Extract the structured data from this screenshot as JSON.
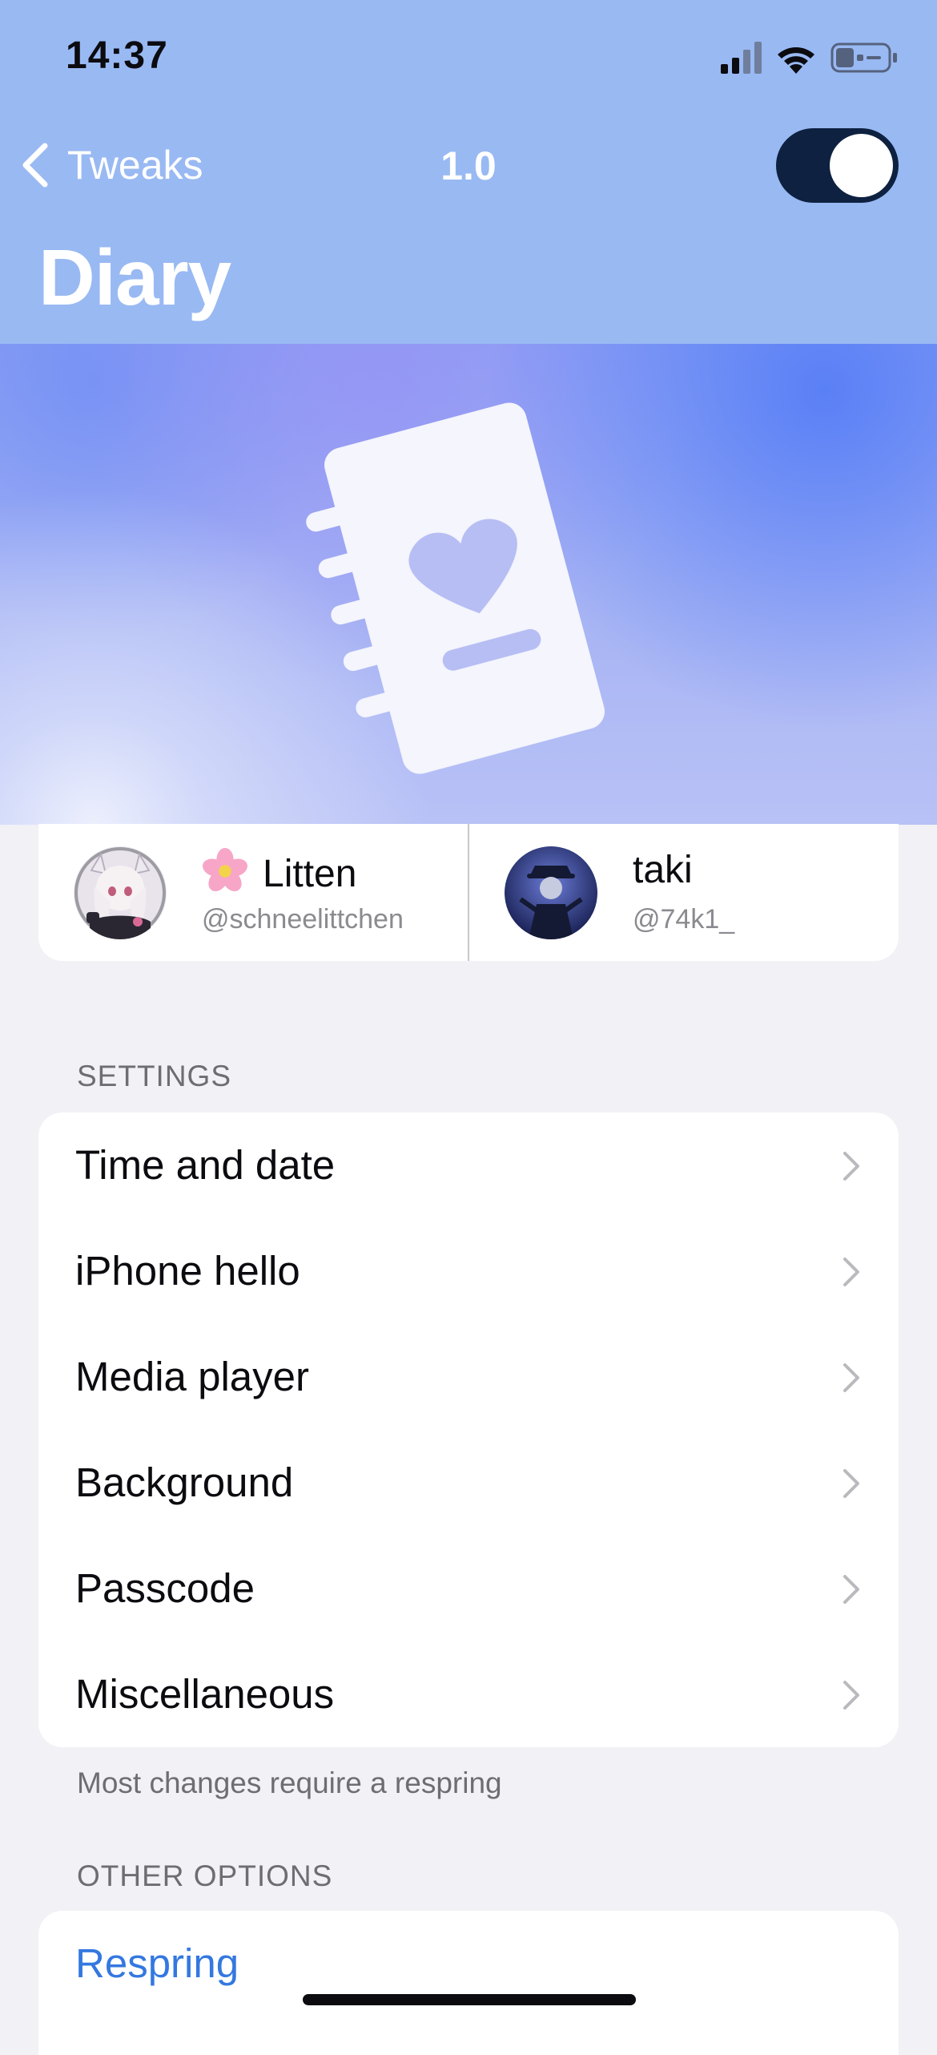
{
  "status_bar": {
    "time": "14:37"
  },
  "nav": {
    "back_label": "Tweaks",
    "version": "1.0",
    "toggle_on": true,
    "title": "Diary"
  },
  "authors": [
    {
      "name": "Litten",
      "handle": "@schneelittchen",
      "emoji": "cherry-blossom-icon"
    },
    {
      "name": "taki",
      "handle": "@74k1_"
    }
  ],
  "settings": {
    "header": "SETTINGS",
    "items": [
      {
        "label": "Time and date"
      },
      {
        "label": "iPhone hello"
      },
      {
        "label": "Media player"
      },
      {
        "label": "Background"
      },
      {
        "label": "Passcode"
      },
      {
        "label": "Miscellaneous"
      }
    ],
    "footer": "Most changes require a respring"
  },
  "other_options": {
    "header": "OTHER OPTIONS",
    "respring_label": "Respring"
  },
  "colors": {
    "header_bg": "#99B9F3",
    "toggle_on": "#0E2140",
    "link_blue": "#3478E0",
    "page_bg": "#F1F1F6"
  }
}
